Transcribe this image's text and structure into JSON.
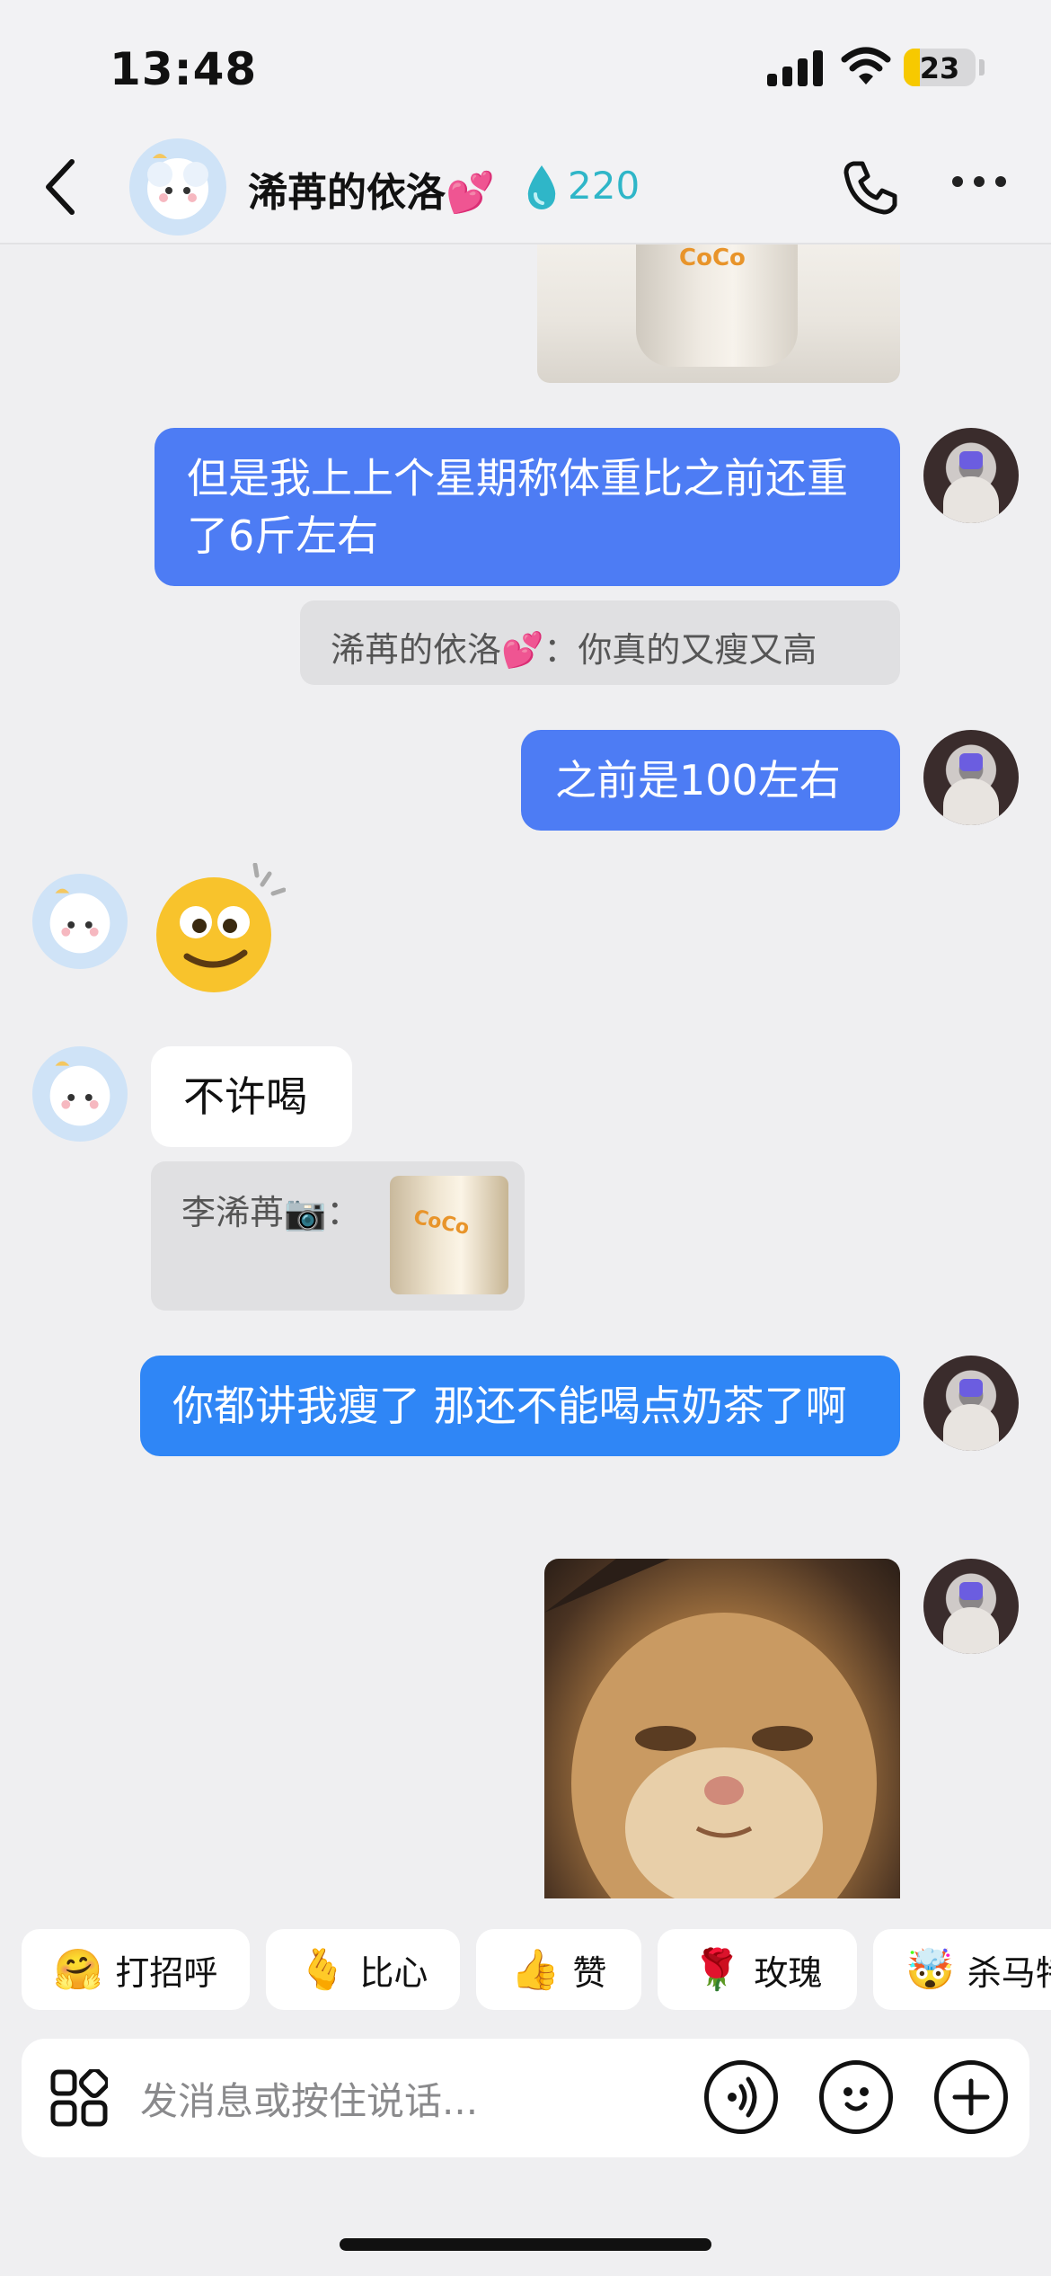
{
  "status_bar": {
    "time": "13:48",
    "battery": "23"
  },
  "header": {
    "contact_name": "浠苒的依洛💕",
    "fire_count": "220"
  },
  "messages": [
    {
      "side": "right",
      "text": "但是我上上个星期称体重比之前还重了6斤左右"
    },
    {
      "quote_author": "浠苒的依洛💕：",
      "quote_text": "你真的又瘦又高"
    },
    {
      "side": "right",
      "text": "之前是100左右"
    },
    {
      "side": "left",
      "type": "emoji",
      "emoji": "🥴"
    },
    {
      "side": "left",
      "text": "不许喝"
    },
    {
      "quote_author": "李浠苒📷："
    },
    {
      "side": "right",
      "text": "你都讲我瘦了 那还不能喝点奶茶了啊"
    }
  ],
  "photo_logo": "CoCo",
  "quick_replies": [
    {
      "icon": "🤗",
      "label": "打招呼"
    },
    {
      "icon": "🫰",
      "label": "比心"
    },
    {
      "icon": "👍",
      "label": "赞"
    },
    {
      "icon": "🌹",
      "label": "玫瑰"
    },
    {
      "icon": "🤯",
      "label": "杀马特"
    }
  ],
  "input": {
    "placeholder": "发消息或按住说话..."
  },
  "colors": {
    "sent_bubble": "#4d7cf4",
    "sent_bubble_alt": "#2f86f6",
    "fire_accent": "#2fb6c8"
  }
}
